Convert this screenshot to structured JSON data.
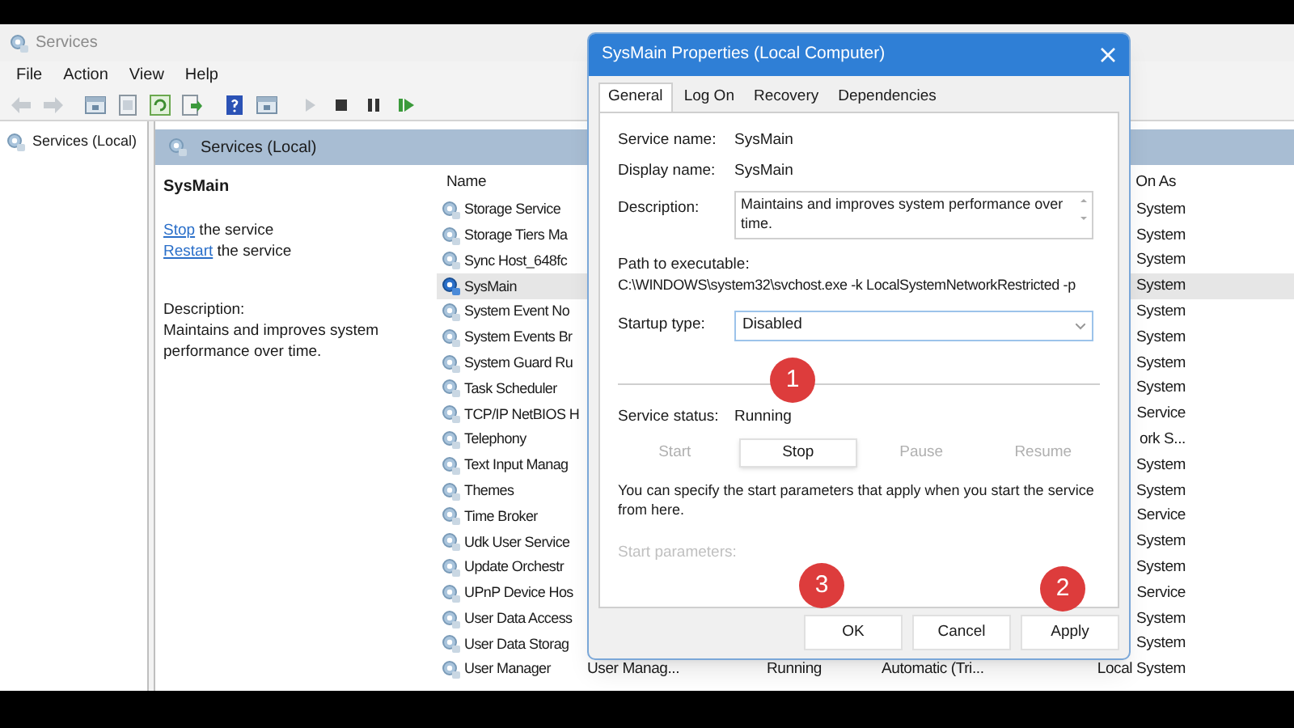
{
  "window": {
    "title": "Services"
  },
  "menu": [
    "File",
    "Action",
    "View",
    "Help"
  ],
  "toolbar": [
    {
      "kind": "back",
      "disabled": true
    },
    {
      "kind": "forward",
      "disabled": true
    },
    {
      "kind": "pane",
      "disabled": false
    },
    {
      "kind": "page",
      "disabled": false
    },
    {
      "kind": "refresh",
      "disabled": false
    },
    {
      "kind": "export",
      "disabled": false
    },
    {
      "kind": "help",
      "disabled": false
    },
    {
      "kind": "pane",
      "disabled": false
    },
    {
      "kind": "play",
      "disabled": true
    },
    {
      "kind": "stop",
      "disabled": false
    },
    {
      "kind": "pause",
      "disabled": false
    },
    {
      "kind": "resume",
      "disabled": false
    }
  ],
  "tree": [
    {
      "label": "Services (Local)",
      "selected": false
    }
  ],
  "panel_header": "Services (Local)",
  "details": {
    "name": "SysMain",
    "actions": [
      {
        "link": "Stop",
        "rest": " the service"
      },
      {
        "link": "Restart",
        "rest": " the service"
      }
    ],
    "description_label": "Description:",
    "description": "Maintains and improves system performance over time."
  },
  "table": {
    "columns": [
      "Name",
      "On As"
    ],
    "rows": [
      {
        "name": "Storage Service",
        "log_on": "System",
        "selected": false
      },
      {
        "name": "Storage Tiers Ma",
        "log_on": "System",
        "selected": false
      },
      {
        "name": "Sync Host_648fc",
        "log_on": "System",
        "selected": false
      },
      {
        "name": "SysMain",
        "log_on": "System",
        "selected": true
      },
      {
        "name": "System Event No",
        "log_on": "System",
        "selected": false
      },
      {
        "name": "System Events Br",
        "log_on": "System",
        "selected": false
      },
      {
        "name": "System Guard Ru",
        "log_on": "System",
        "selected": false
      },
      {
        "name": "Task Scheduler",
        "log_on": "System",
        "selected": false
      },
      {
        "name": "TCP/IP NetBIOS H",
        "log_on": "Service",
        "selected": false
      },
      {
        "name": "Telephony",
        "log_on": "ork S...",
        "selected": false
      },
      {
        "name": "Text Input Manag",
        "log_on": "System",
        "selected": false
      },
      {
        "name": "Themes",
        "log_on": "System",
        "selected": false
      },
      {
        "name": "Time Broker",
        "log_on": "Service",
        "selected": false
      },
      {
        "name": "Udk User Service",
        "log_on": "System",
        "selected": false
      },
      {
        "name": "Update Orchestr",
        "log_on": "System",
        "selected": false
      },
      {
        "name": "UPnP Device Hos",
        "log_on": "Service",
        "selected": false
      },
      {
        "name": "User Data Access",
        "log_on": "System",
        "selected": false
      },
      {
        "name": "User Data Storag",
        "log_on": "System",
        "selected": false
      },
      {
        "name": "User Manager",
        "description": "User Manag...",
        "status": "Running",
        "startup_type": "Automatic (Tri...",
        "log_on": "Local System",
        "selected": false
      }
    ]
  },
  "dialog": {
    "title": "SysMain Properties (Local Computer)",
    "tabs": [
      {
        "label": "General",
        "selected": true
      },
      {
        "label": "Log On",
        "selected": false
      },
      {
        "label": "Recovery",
        "selected": false
      },
      {
        "label": "Dependencies",
        "selected": false
      }
    ],
    "service_name": {
      "label": "Service name:",
      "value": "SysMain"
    },
    "display_name": {
      "label": "Display name:",
      "value": "SysMain"
    },
    "description": {
      "label": "Description:",
      "value": "Maintains and improves system performance over time."
    },
    "path": {
      "label": "Path to executable:",
      "value": "C:\\WINDOWS\\system32\\svchost.exe -k LocalSystemNetworkRestricted -p"
    },
    "startup_type": {
      "label": "Startup type:",
      "value": "Disabled"
    },
    "service_status": {
      "label": "Service status:",
      "value": "Running"
    },
    "control_buttons": [
      {
        "label": "Start",
        "disabled": true
      },
      {
        "label": "Stop",
        "disabled": false
      },
      {
        "label": "Pause",
        "disabled": true
      },
      {
        "label": "Resume",
        "disabled": true
      }
    ],
    "hint": "You can specify the start parameters that apply when you start the service from here.",
    "start_parameters": {
      "label": "Start parameters:",
      "disabled": true
    },
    "buttons": [
      "OK",
      "Cancel",
      "Apply"
    ]
  },
  "markers": [
    {
      "label": "1"
    },
    {
      "label": "3"
    },
    {
      "label": "2"
    }
  ]
}
